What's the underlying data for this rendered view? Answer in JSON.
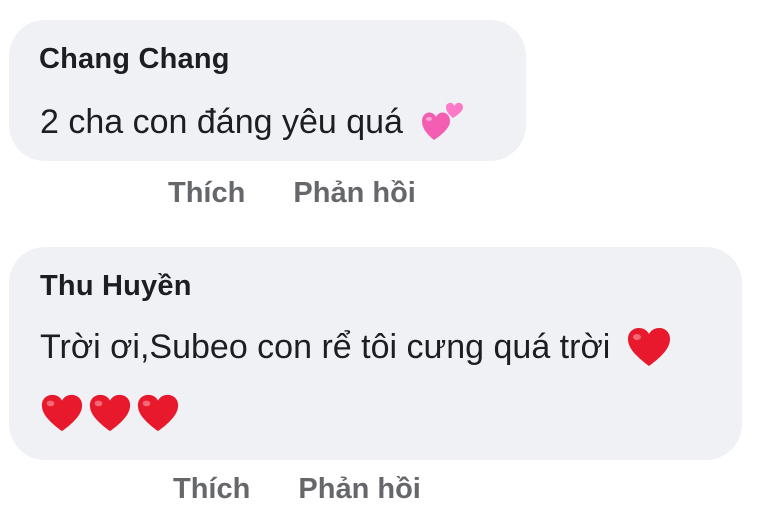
{
  "comments": [
    {
      "author": "Chang Chang",
      "text": "2 cha con đáng yêu quá",
      "trailing_emoji": "two-hearts-icon",
      "actions": {
        "like": "Thích",
        "reply": "Phản hồi"
      }
    },
    {
      "author": "Thu Huyền",
      "text": "Trời ơi,Subeo con rể tôi cưng quá trời",
      "trailing_emoji": "red-heart-icon",
      "emoji_line": [
        "red-heart-icon",
        "red-heart-icon",
        "red-heart-icon"
      ],
      "actions": {
        "like": "Thích",
        "reply": "Phản hồi"
      }
    }
  ],
  "colors": {
    "bubble": "#eff1f4",
    "text": "#1c1e21",
    "action": "#65676b",
    "heart_red": "#e8192c",
    "heart_pink": "#f35eb3"
  }
}
